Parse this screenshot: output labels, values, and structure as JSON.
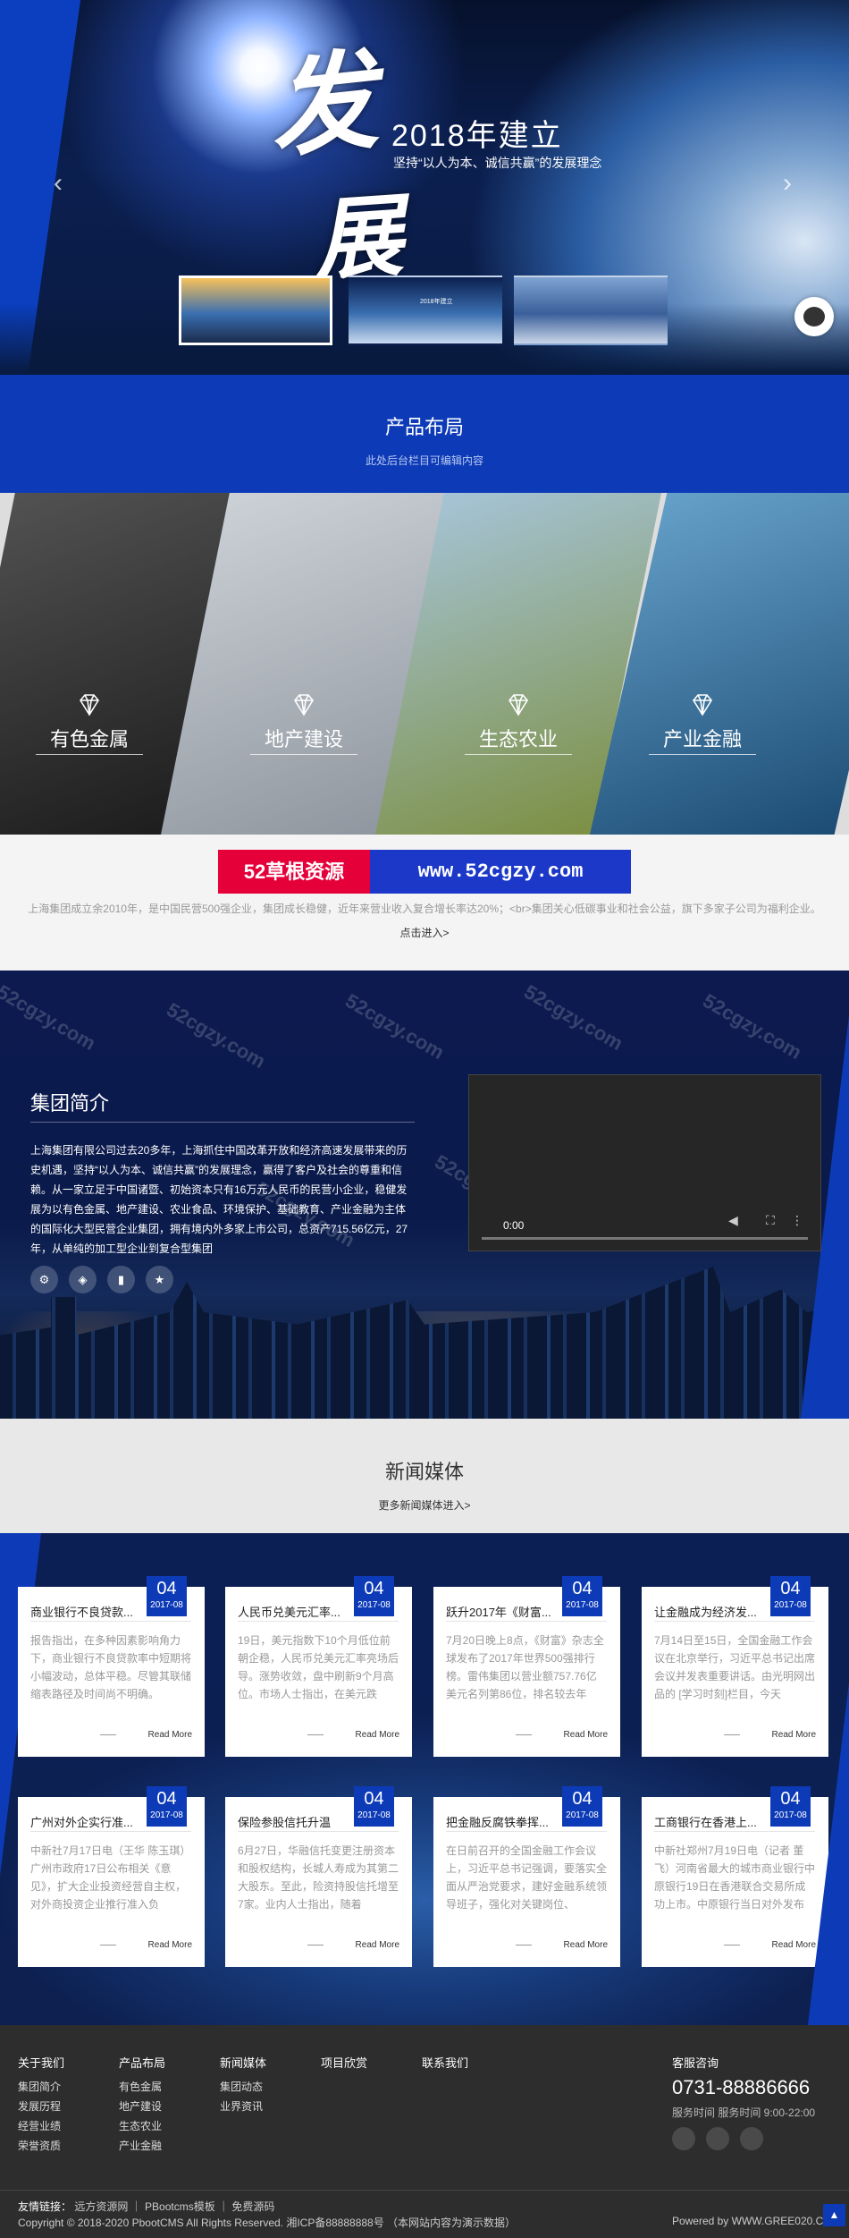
{
  "hero": {
    "big_char_1": "发",
    "big_char_2": "展",
    "title": "2018年建立",
    "subtitle": "坚持“以人为本、诚信共赢”的发展理念",
    "prev_label": "‹",
    "next_label": "›",
    "thumbs": [
      {
        "label": "",
        "colors": [
          "#f7c15a",
          "#3a6fb0",
          "#1b2c4d"
        ]
      },
      {
        "label": "2018年建立",
        "colors": [
          "#0b1f4f",
          "#3a6fb0",
          "#c8d9ef"
        ]
      },
      {
        "label": "",
        "colors": [
          "#7fa3d2",
          "#3a5f9a",
          "#c9d6e8"
        ]
      }
    ]
  },
  "products_header": {
    "title": "产品布局",
    "subtitle": "此处后台栏目可编辑内容"
  },
  "products": [
    {
      "label": "有色金属",
      "colors": [
        "#1a1a1a",
        "#555555"
      ]
    },
    {
      "label": "地产建设",
      "colors": [
        "#8c939c",
        "#d0d5da"
      ]
    },
    {
      "label": "生态农业",
      "colors": [
        "#7a8c3a",
        "#a8c7e0"
      ]
    },
    {
      "label": "产业金融",
      "colors": [
        "#17466e",
        "#6aa6cf"
      ]
    }
  ],
  "intro": {
    "banner_left": "52草根资源",
    "banner_right": "www.52cgzy.com",
    "text": "上海集团成立余2010年，是中国民营500强企业，集团成长稳健，近年来营业收入复合增长率达20%；<br>集团关心低碳事业和社会公益，旗下多家子公司为福利企业。",
    "more": "点击进入>"
  },
  "about": {
    "title": "集团简介",
    "description": "上海集团有限公司过去20多年，上海抓住中国改革开放和经济高速发展带来的历史机遇，坚持“以人为本、诚信共赢”的发展理念，赢得了客户及社会的尊重和信赖。从一家立足于中国诸暨、初始资本只有16万元人民币的民营小企业，稳健发展为以有色金属、地产建设、农业食品、环境保护、基础教育、产业金融为主体的国际化大型民营企业集团，拥有境内外多家上市公司，总资产715.56亿元，27年，从单纯的加工型企业到复合型集团",
    "video_time": "0:00",
    "watermark": "52cgzy.com"
  },
  "news_header": {
    "title": "新闻媒体",
    "more": "更多新闻媒体进入>"
  },
  "news": [
    {
      "day": "04",
      "month": "2017-08",
      "title": "商业银行不良贷款...",
      "desc": "报告指出，在多种因素影响角力下，商业银行不良贷款率中短期将小幅波动，总体平稳。尽管其联储缩表路径及时间尚不明确。",
      "more": "Read More"
    },
    {
      "day": "04",
      "month": "2017-08",
      "title": "人民币兑美元汇率...",
      "desc": "19日，美元指数下10个月低位前朝企稳，人民币兑美元汇率亮场后导。涨势收敛，盘中刷新9个月高位。市场人士指出，在美元跌",
      "more": "Read More"
    },
    {
      "day": "04",
      "month": "2017-08",
      "title": "跃升2017年《财富...",
      "desc": "7月20日晚上8点，《财富》杂志全球发布了2017年世界500强排行榜。雷伟集团以营业额757.76亿美元名列第86位，排名较去年",
      "more": "Read More"
    },
    {
      "day": "04",
      "month": "2017-08",
      "title": "让金融成为经济发...",
      "desc": "7月14日至15日，全国金融工作会议在北京举行，习近平总书记出席会议并发表重要讲话。由光明网出品的 [学习时刻]栏目，今天",
      "more": "Read More"
    },
    {
      "day": "04",
      "month": "2017-08",
      "title": "广州对外企实行准...",
      "desc": "中新社7月17日电（王华 陈玉琪）广州市政府17日公布相关《意见》，扩大企业投资经营自主权，对外商投资企业推行准入负",
      "more": "Read More"
    },
    {
      "day": "04",
      "month": "2017-08",
      "title": "保险参股信托升温",
      "desc": "6月27日，华融信托变更注册资本和股权结构，长城人寿成为其第二大股东。至此，险资持股信托增至7家。业内人士指出，随着",
      "more": "Read More"
    },
    {
      "day": "04",
      "month": "2017-08",
      "title": "把金融反腐铁拳挥...",
      "desc": "在日前召开的全国金融工作会议上，习近平总书记强调，要落实全面从严治党要求，建好金融系统领导班子，强化对关键岗位、",
      "more": "Read More"
    },
    {
      "day": "04",
      "month": "2017-08",
      "title": "工商银行在香港上...",
      "desc": "中新社郑州7月19日电（记者 董飞）河南省最大的城市商业银行中原银行19日在香港联合交易所成功上市。中原银行当日对外发布",
      "more": "Read More"
    }
  ],
  "footer": {
    "columns": [
      {
        "title": "关于我们",
        "items": [
          "集团简介",
          "发展历程",
          "经营业绩",
          "荣誉资质"
        ]
      },
      {
        "title": "产品布局",
        "items": [
          "有色金属",
          "地产建设",
          "生态农业",
          "产业金融"
        ]
      },
      {
        "title": "新闻媒体",
        "items": [
          "集团动态",
          "业界资讯"
        ]
      },
      {
        "title": "项目欣赏",
        "items": []
      },
      {
        "title": "联系我们",
        "items": []
      }
    ],
    "contact_title": "客服咨询",
    "phone": "0731-88886666",
    "hours": "服务时间 服务时间 9:00-22:00",
    "links_label": "友情链接：",
    "links": [
      "远方资源网",
      "PBootcms模板",
      "免费源码"
    ],
    "copyright": "Copyright © 2018-2020 PbootCMS All Rights Reserved. 湘ICP备88888888号 （本网站内容为演示数据）",
    "powered": "Powered by WWW.GREE020.CN",
    "totop": "▲"
  },
  "colors": {
    "brand_blue": "#0d3bb8",
    "footer_bg": "#2d2d2d"
  }
}
